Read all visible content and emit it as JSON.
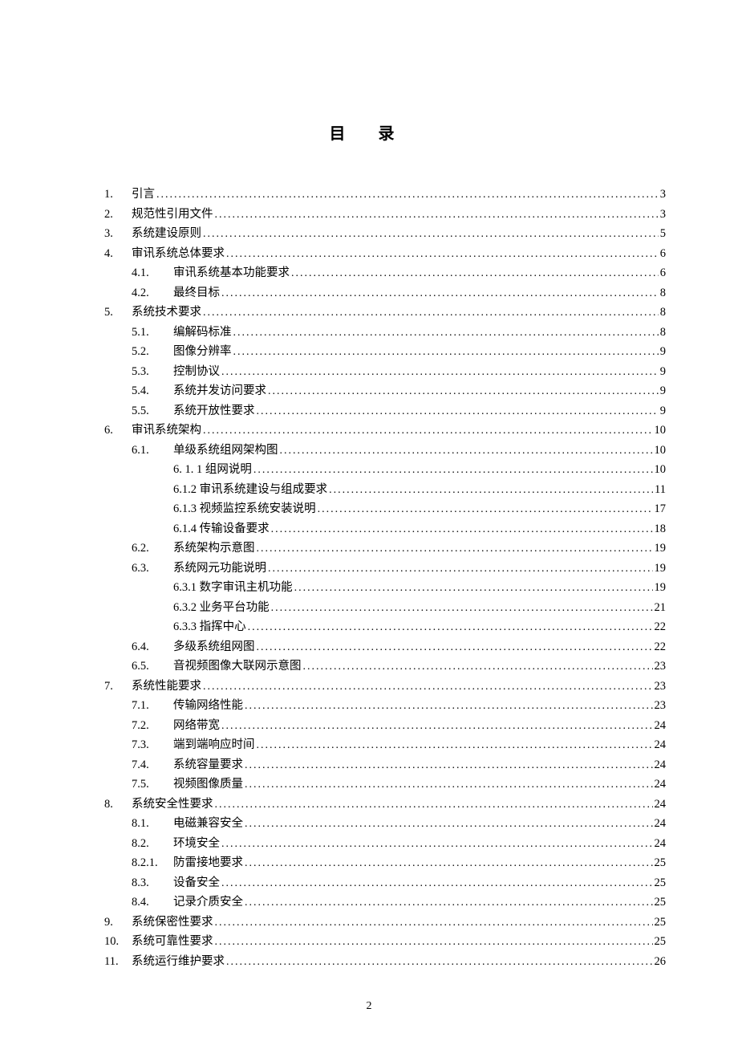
{
  "title": "目 录",
  "page_number": "2",
  "toc": [
    {
      "level": 1,
      "num": "1.",
      "label": "引言",
      "page": "3"
    },
    {
      "level": 1,
      "num": "2.",
      "label": "规范性引用文件",
      "page": "3"
    },
    {
      "level": 1,
      "num": "3.",
      "label": "系统建设原则",
      "page": "5"
    },
    {
      "level": 1,
      "num": "4.",
      "label": "审讯系统总体要求",
      "page": "6"
    },
    {
      "level": 2,
      "num": "4.1.",
      "label": "审讯系统基本功能要求",
      "page": "6"
    },
    {
      "level": 2,
      "num": "4.2.",
      "label": "最终目标",
      "page": "8"
    },
    {
      "level": 1,
      "num": "5.",
      "label": "系统技术要求",
      "page": "8"
    },
    {
      "level": 2,
      "num": "5.1.",
      "label": "编解码标准",
      "page": "8"
    },
    {
      "level": 2,
      "num": "5.2.",
      "label": "图像分辨率",
      "page": "9"
    },
    {
      "level": 2,
      "num": "5.3.",
      "label": "控制协议",
      "page": "9"
    },
    {
      "level": 2,
      "num": "5.4.",
      "label": "系统并发访问要求",
      "page": "9"
    },
    {
      "level": 2,
      "num": "5.5.",
      "label": "系统开放性要求",
      "page": "9"
    },
    {
      "level": 1,
      "num": "6.",
      "label": "审讯系统架构",
      "page": "10"
    },
    {
      "level": 2,
      "num": "6.1.",
      "label": "单级系统组网架构图",
      "page": "10"
    },
    {
      "level": 3,
      "num": "",
      "label": "6. 1. 1 组网说明",
      "page": "10"
    },
    {
      "level": 3,
      "num": "",
      "label": "6.1.2 审讯系统建设与组成要求",
      "page": "11"
    },
    {
      "level": 3,
      "num": "",
      "label": "6.1.3 视频监控系统安装说明",
      "page": "17"
    },
    {
      "level": 3,
      "num": "",
      "label": "6.1.4 传输设备要求",
      "page": "18"
    },
    {
      "level": 2,
      "num": "6.2.",
      "label": "系统架构示意图",
      "page": "19"
    },
    {
      "level": 2,
      "num": "6.3.",
      "label": "系统网元功能说明",
      "page": "19"
    },
    {
      "level": 3,
      "num": "",
      "label": "6.3.1 数字审讯主机功能",
      "page": "19"
    },
    {
      "level": 3,
      "num": "",
      "label": "6.3.2 业务平台功能",
      "page": "21"
    },
    {
      "level": 3,
      "num": "",
      "label": "6.3.3 指挥中心",
      "page": "22"
    },
    {
      "level": 2,
      "num": "6.4.",
      "label": "多级系统组网图",
      "page": "22"
    },
    {
      "level": 2,
      "num": "6.5.",
      "label": "音视频图像大联网示意图",
      "page": "23"
    },
    {
      "level": 1,
      "num": "7.",
      "label": "系统性能要求",
      "page": "23"
    },
    {
      "level": 2,
      "num": "7.1.",
      "label": "传输网络性能",
      "page": "23"
    },
    {
      "level": 2,
      "num": "7.2.",
      "label": "网络带宽",
      "page": "24"
    },
    {
      "level": 2,
      "num": "7.3.",
      "label": "端到端响应时间",
      "page": "24"
    },
    {
      "level": 2,
      "num": "7.4.",
      "label": "系统容量要求",
      "page": "24"
    },
    {
      "level": 2,
      "num": "7.5.",
      "label": "视频图像质量",
      "page": "24"
    },
    {
      "level": 1,
      "num": "8.",
      "label": "系统安全性要求",
      "page": "24"
    },
    {
      "level": 2,
      "num": "8.1.",
      "label": "电磁兼容安全",
      "page": "24"
    },
    {
      "level": 2,
      "num": "8.2.",
      "label": "环境安全",
      "page": "24"
    },
    {
      "level": 2,
      "num": "8.2.1.",
      "label": "防雷接地要求",
      "page": "25"
    },
    {
      "level": 2,
      "num": "8.3.",
      "label": "设备安全",
      "page": "25"
    },
    {
      "level": 2,
      "num": "8.4.",
      "label": "记录介质安全",
      "page": "25"
    },
    {
      "level": 1,
      "num": "9.",
      "label": "系统保密性要求",
      "page": "25"
    },
    {
      "level": 1,
      "num": "10.",
      "label": "系统可靠性要求",
      "page": "25"
    },
    {
      "level": 1,
      "num": "11.",
      "label": "系统运行维护要求",
      "page": "26"
    }
  ]
}
